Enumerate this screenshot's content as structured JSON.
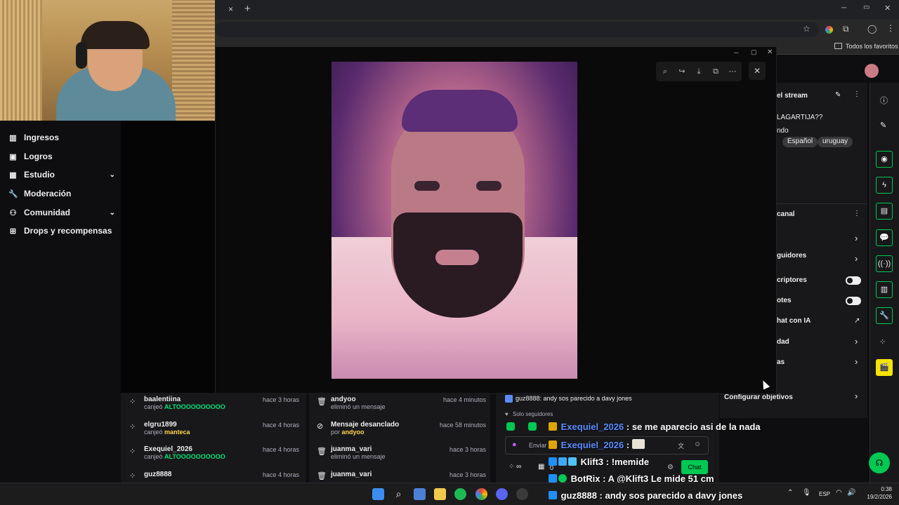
{
  "browser": {
    "close_tab_glyph": "×",
    "new_tab_glyph": "+",
    "bookmarks_label": "Todos los favoritos"
  },
  "sidebar": {
    "items": [
      {
        "label": "Ingresos",
        "icon": "chart-bar-icon"
      },
      {
        "label": "Logros",
        "icon": "trophy-icon"
      },
      {
        "label": "Estudio",
        "icon": "video-icon",
        "expandable": true
      },
      {
        "label": "Moderación",
        "icon": "wrench-icon"
      },
      {
        "label": "Comunidad",
        "icon": "people-icon",
        "expandable": true
      },
      {
        "label": "Drops y recompensas",
        "icon": "gift-icon"
      }
    ]
  },
  "stream_panel": {
    "header": "el stream",
    "title_fragment": "LAGARTIJA??",
    "category_fragment": "ndo",
    "tags": [
      "Español",
      "uruguay"
    ]
  },
  "channel_panel": {
    "header": "canal",
    "rows": [
      {
        "label": "guidores",
        "control": "chevron"
      },
      {
        "label": "criptores",
        "control": "toggle"
      },
      {
        "label": "otes",
        "control": "toggle"
      },
      {
        "label": "hat con IA",
        "control": "external"
      },
      {
        "label": "dad",
        "control": "chevron"
      },
      {
        "label": "as",
        "control": "chevron"
      }
    ],
    "configure_goals": "Configurar objetivos"
  },
  "activity_feed_left": [
    {
      "user": "baalentiina",
      "action": "canjeó",
      "reward": "ALTOOOOOOOOOO",
      "time": "hace 3 horas"
    },
    {
      "user": "elgru1899",
      "action": "canjeó",
      "reward": "manteca",
      "time": "hace 4 horas"
    },
    {
      "user": "Exequiel_2026",
      "action": "canjeó",
      "reward": "ALTOOOOOOOOOO",
      "time": "hace 4 horas"
    },
    {
      "user": "guz8888",
      "action": "",
      "reward": "",
      "time": "hace 4 horas"
    }
  ],
  "activity_feed_mid": [
    {
      "user": "andyoo",
      "action": "eliminó un mensaje",
      "by": "",
      "time": "hace 4 minutos"
    },
    {
      "user": "Mensaje desanclado",
      "action": "por",
      "by": "andyoo",
      "time": "hace 58 minutos"
    },
    {
      "user": "juanma_vari",
      "action": "eliminó un mensaje",
      "by": "",
      "time": "hace 3 horas"
    },
    {
      "user": "juanma_vari",
      "action": "",
      "by": "",
      "time": "hace 3 horas"
    }
  ],
  "chat_panel": {
    "pinned": "guz8888: andy sos parecido a davy jones",
    "followers_only": "Solo seguidores",
    "input_placeholder": "Enviar",
    "chat_button": "Chat",
    "points": "0"
  },
  "chat_overlay": [
    {
      "user": "Exequiel_2026",
      "sep": " : ",
      "text": "se me aparecio asi de la nada",
      "color": "#5b8cff"
    },
    {
      "user": "Exequiel_2026",
      "sep": " : ",
      "text": "",
      "color": "#5b8cff"
    },
    {
      "user": "Klift3",
      "sep": " : ",
      "text": "!memide",
      "color": "#ffffff"
    },
    {
      "user": "BotRix",
      "sep": " : ",
      "text": "A @Klift3 Le mide 51 cm",
      "color": "#ffffff"
    },
    {
      "user": "guz8888",
      "sep": " : ",
      "text": "andy sos parecido a davy jones",
      "color": "#ffffff"
    }
  ],
  "taskbar": {
    "language": "ESP",
    "time": "0:38",
    "date": "19/2/2026"
  },
  "colors": {
    "accent_green": "#00c853",
    "reward_green": "#00e676",
    "panel_bg": "#18181b",
    "page_bg": "#0e0e10"
  }
}
